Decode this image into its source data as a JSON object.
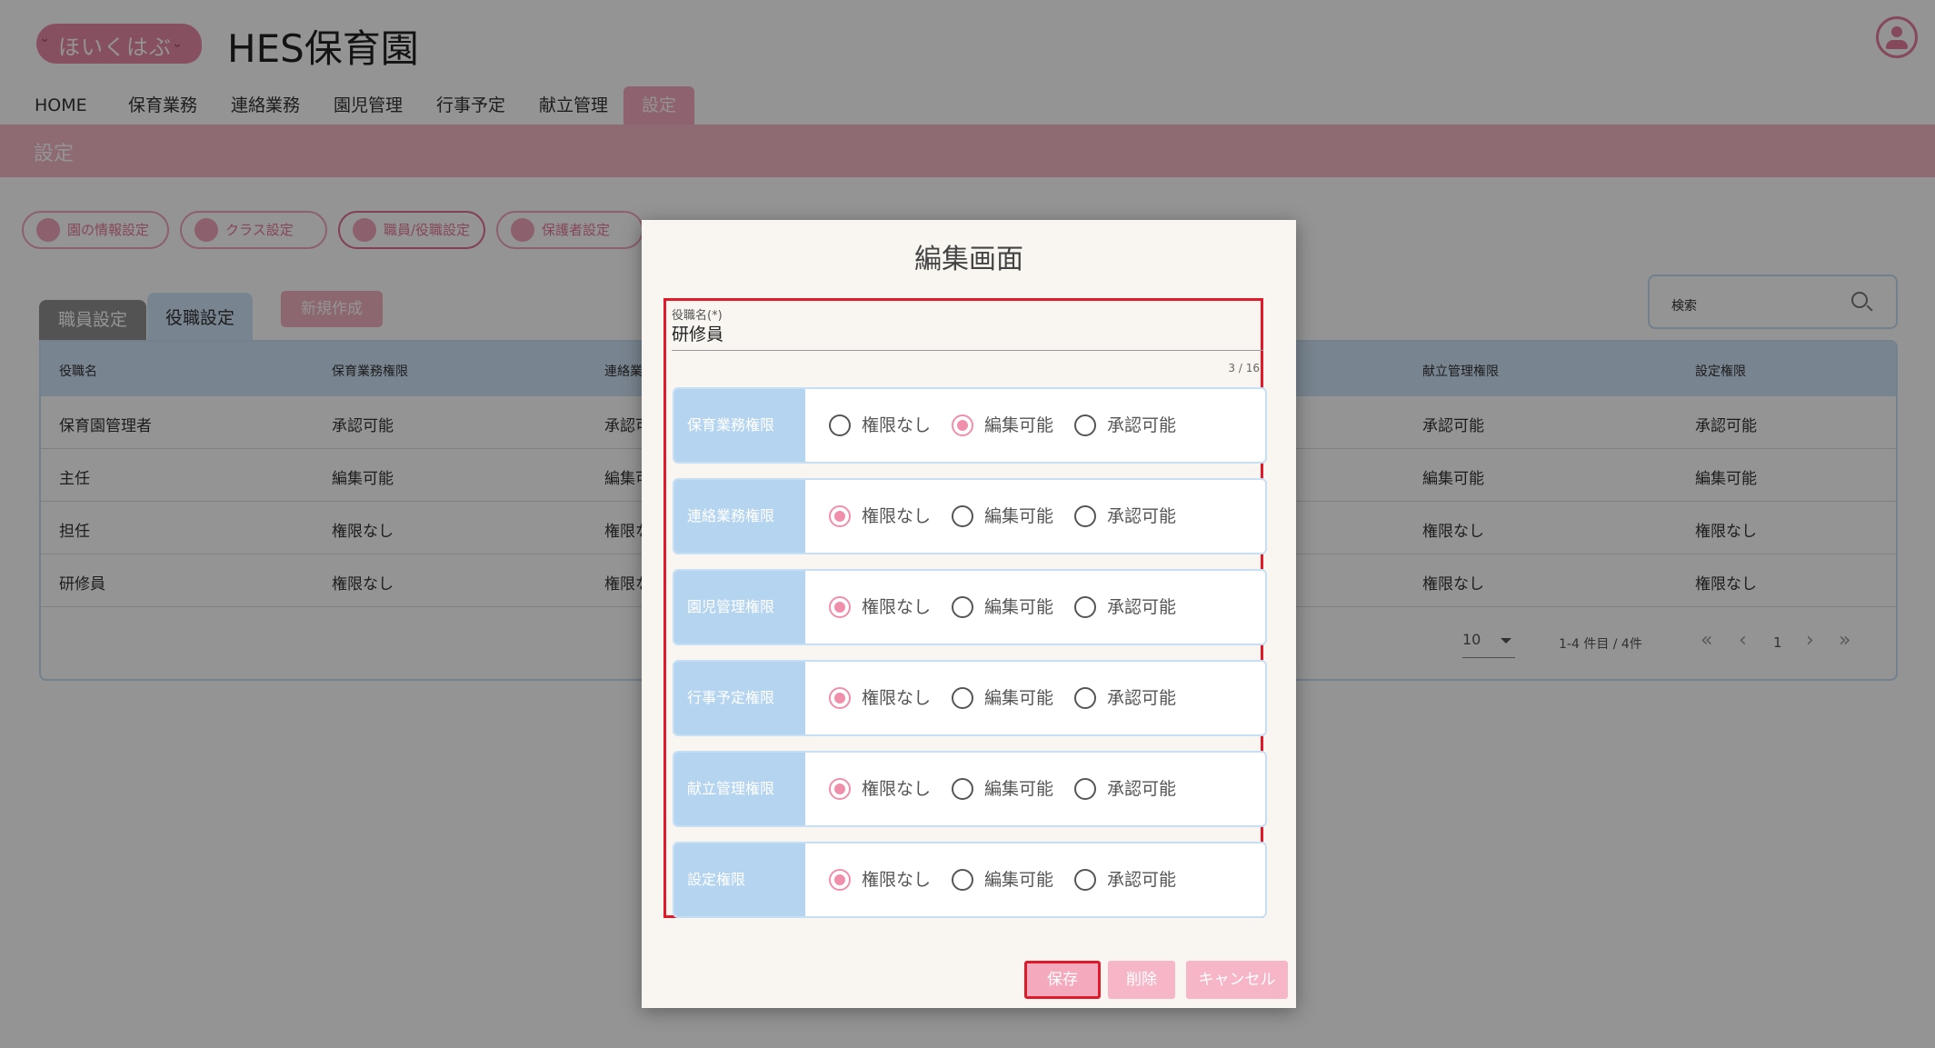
{
  "header": {
    "logo_text": "ほいくはぶ",
    "app_title": "HES保育園"
  },
  "nav": {
    "items": [
      "HOME",
      "保育業務",
      "連絡業務",
      "園児管理",
      "行事予定",
      "献立管理",
      "設定"
    ],
    "active": "設定"
  },
  "page": {
    "title": "設定"
  },
  "settings_chips": [
    "園の情報設定",
    "クラス設定",
    "職員/役職設定",
    "保護者設定"
  ],
  "tabs": {
    "staff": "職員設定",
    "roles": "役職設定"
  },
  "new_button": "新規作成",
  "search": {
    "label": "検索"
  },
  "table": {
    "headers": [
      "役職名",
      "保育業務権限",
      "連絡業",
      "献立管理権限",
      "設定権限"
    ],
    "rows": [
      [
        "保育園管理者",
        "承認可能",
        "承認可",
        "承認可能",
        "承認可能"
      ],
      [
        "主任",
        "編集可能",
        "編集可",
        "編集可能",
        "編集可能"
      ],
      [
        "担任",
        "権限なし",
        "権限な",
        "権限なし",
        "権限なし"
      ],
      [
        "研修員",
        "権限なし",
        "権限な",
        "権限なし",
        "権限なし"
      ]
    ],
    "pager": {
      "per_page": "10",
      "range": "1-4 件目 / 4件",
      "first": "«",
      "prev": "‹",
      "page": "1",
      "next": "›",
      "last": "»"
    }
  },
  "modal": {
    "title": "編集画面",
    "field_label": "役職名(*)",
    "field_value": "研修員",
    "counter": "3 / 16",
    "options": [
      "権限なし",
      "編集可能",
      "承認可能"
    ],
    "permissions": [
      {
        "label": "保育業務権限",
        "selected": "編集可能"
      },
      {
        "label": "連絡業務権限",
        "selected": "権限なし"
      },
      {
        "label": "園児管理権限",
        "selected": "権限なし"
      },
      {
        "label": "行事予定権限",
        "selected": "権限なし"
      },
      {
        "label": "献立管理権限",
        "selected": "権限なし"
      },
      {
        "label": "設定権限",
        "selected": "権限なし"
      }
    ],
    "buttons": {
      "save": "保存",
      "delete": "削除",
      "cancel": "キャンセル"
    }
  },
  "colors": {
    "brand_pink": "#e98aa6",
    "accent_blue": "#cfe4f7",
    "highlight_red": "#e01a2b"
  }
}
